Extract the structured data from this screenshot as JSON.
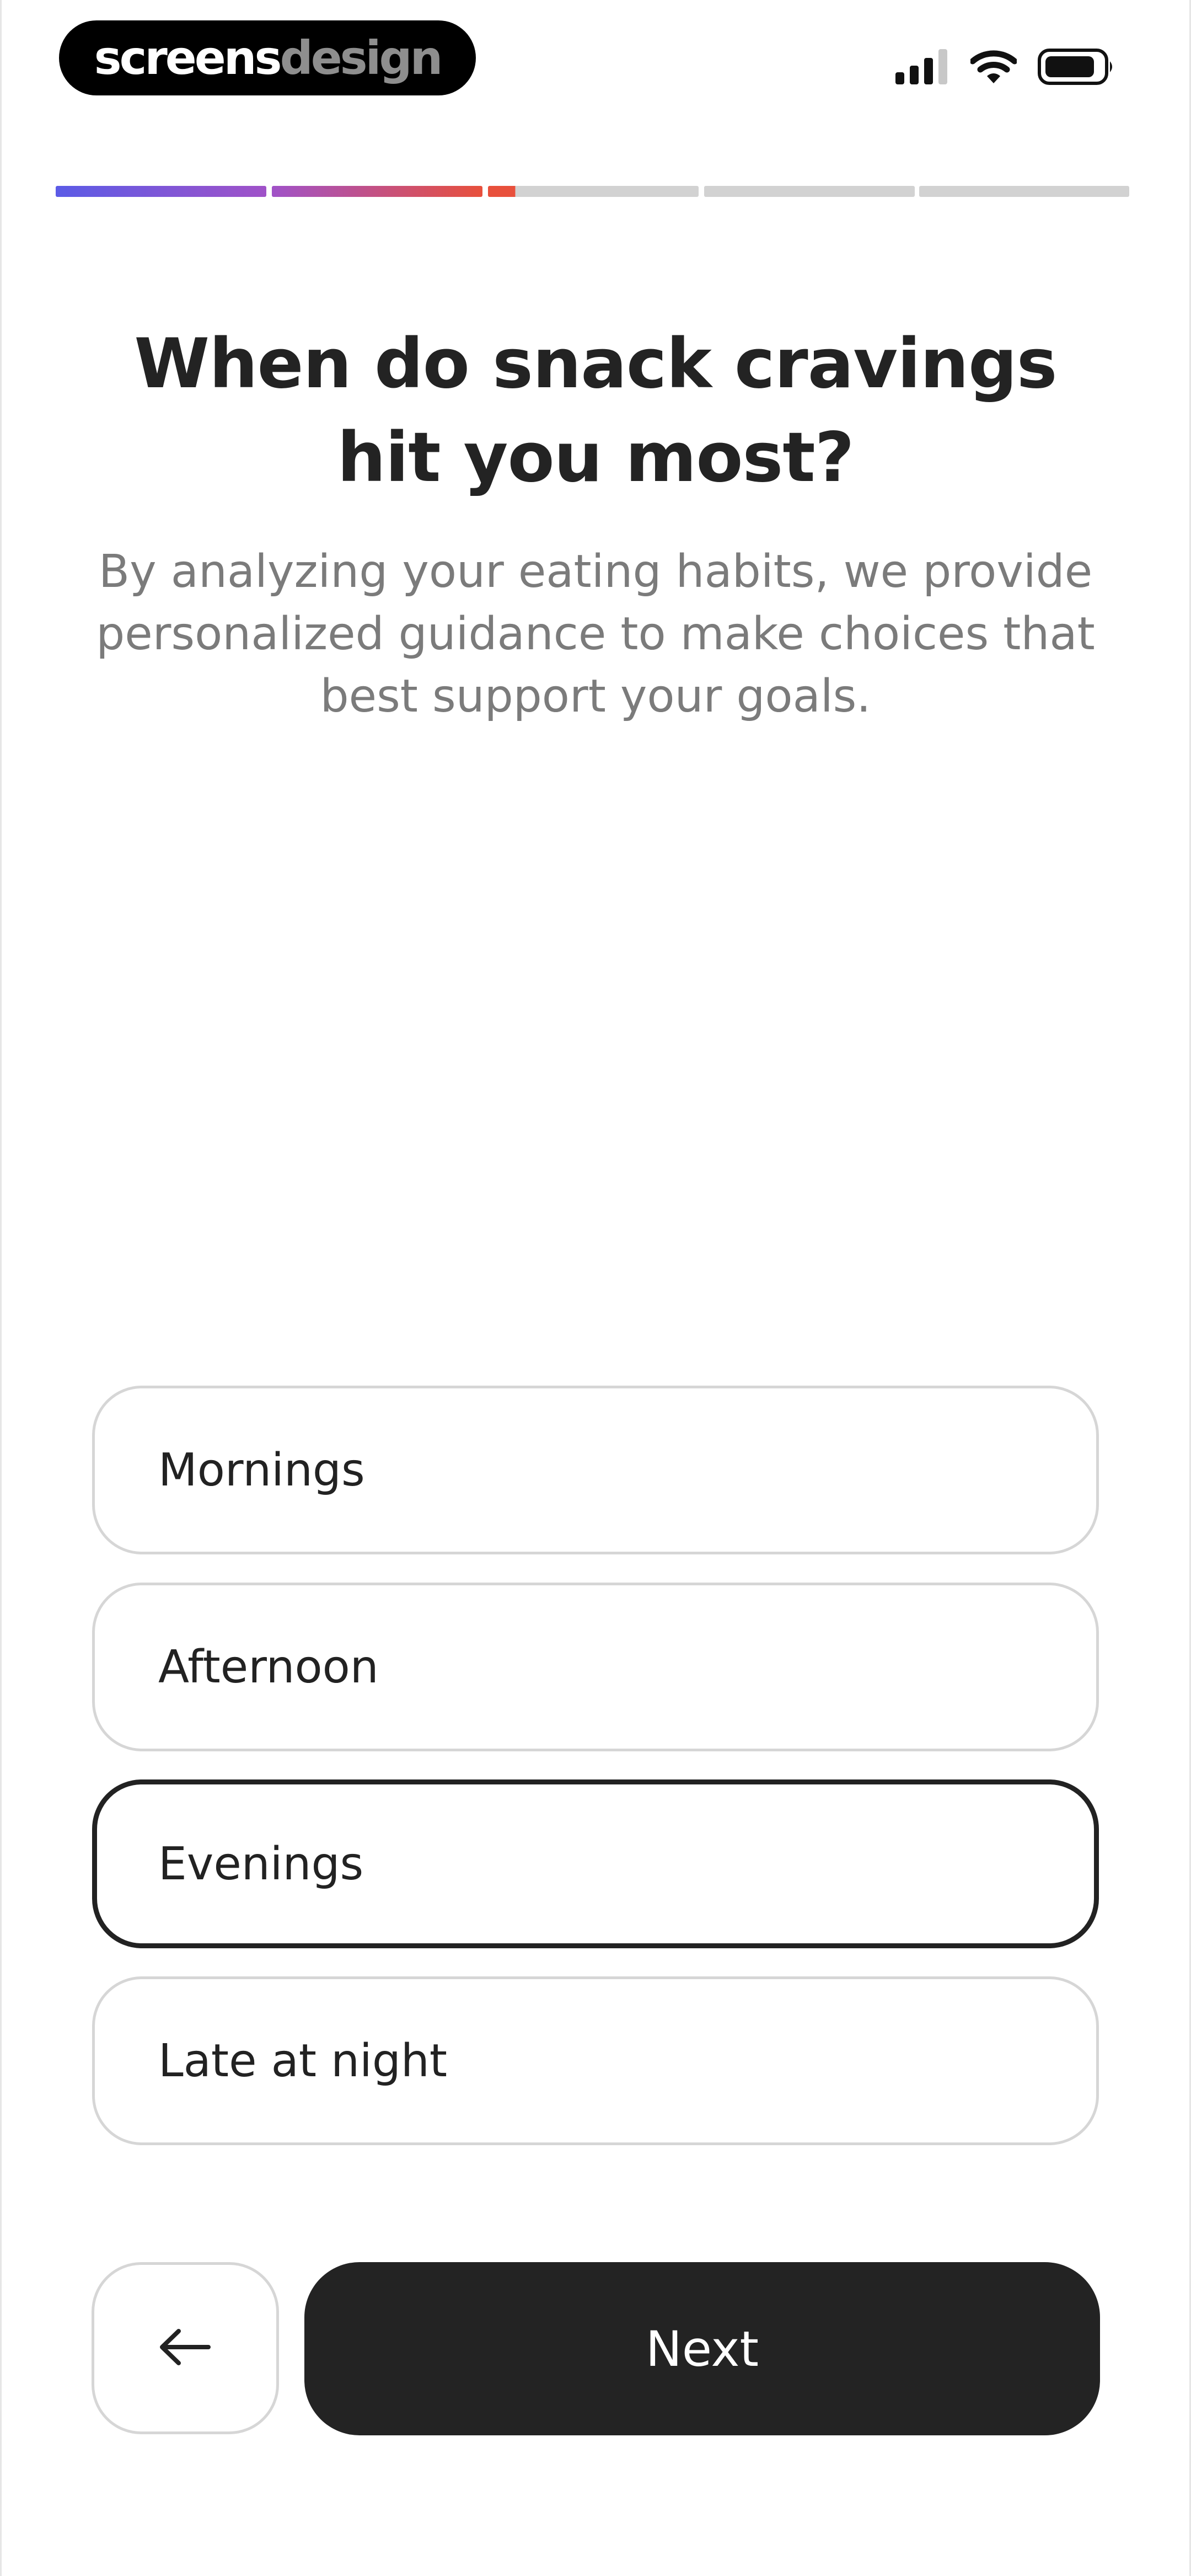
{
  "status_bar": {
    "brand_part1": "screens",
    "brand_part2": "design",
    "icons": [
      "signal-icon",
      "wifi-icon",
      "battery-icon"
    ]
  },
  "progress": {
    "total_steps": 6,
    "completed_steps": 2,
    "current_step_fraction": 0.13,
    "colors": {
      "gradient_start": "#5B5BE6",
      "gradient_mid": "#A052C8",
      "gradient_end": "#E8503C",
      "inactive": "#D2D2D2"
    }
  },
  "question": {
    "title": "When do snack cravings hit you most?",
    "subtitle": "By analyzing your eating habits, we provide personalized guidance to make choices that best support your goals."
  },
  "options": [
    {
      "label": "Mornings",
      "selected": false
    },
    {
      "label": "Afternoon",
      "selected": false
    },
    {
      "label": "Evenings",
      "selected": true
    },
    {
      "label": "Late at night",
      "selected": false
    }
  ],
  "buttons": {
    "back_icon": "arrow-left-icon",
    "next_label": "Next"
  }
}
